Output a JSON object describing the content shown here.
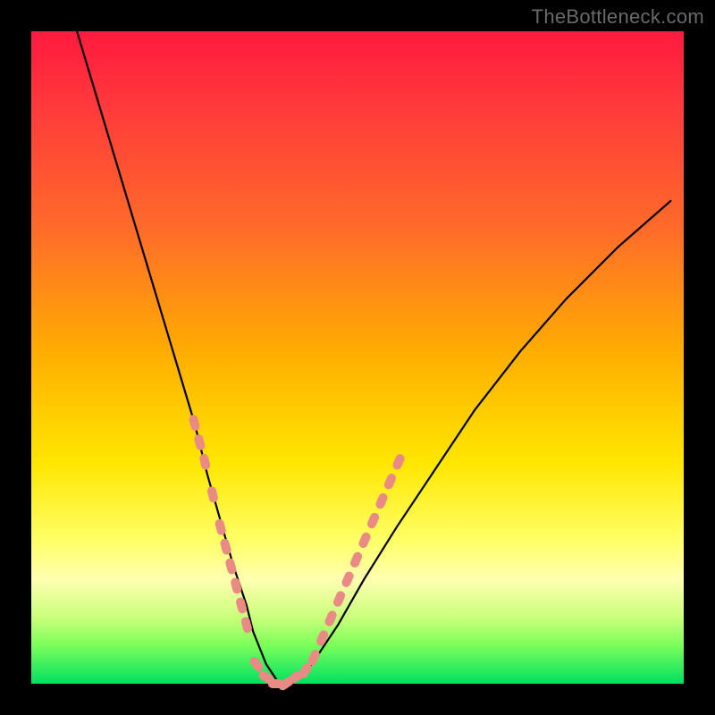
{
  "watermark": "TheBottleneck.com",
  "chart_data": {
    "type": "line",
    "title": "",
    "xlabel": "",
    "ylabel": "",
    "xlim": [
      0,
      100
    ],
    "ylim": [
      0,
      100
    ],
    "grid": false,
    "legend": false,
    "background_gradient": {
      "top": "#ff1a3f",
      "mid": "#ffe600",
      "bottom": "#00e060"
    },
    "series": [
      {
        "name": "bottleneck-curve",
        "color": "#000000",
        "x": [
          7,
          10,
          13,
          16,
          19,
          22,
          25,
          27,
          29,
          31,
          33,
          34,
          36,
          38,
          40,
          43,
          47,
          51,
          56,
          62,
          68,
          75,
          82,
          90,
          98
        ],
        "y": [
          100,
          90,
          80,
          70,
          60,
          50,
          40,
          32,
          25,
          18,
          12,
          8,
          3,
          0,
          0,
          3,
          9,
          16,
          24,
          33,
          42,
          51,
          59,
          67,
          74
        ]
      },
      {
        "name": "highlight-dots-left",
        "type": "scatter",
        "color": "#e98b84",
        "marker": "pill",
        "x": [
          25.0,
          25.8,
          26.6,
          27.8,
          29.0,
          29.8,
          30.6,
          31.4,
          32.2,
          33.0
        ],
        "y": [
          40,
          37,
          34,
          29,
          24,
          21,
          18,
          15,
          12,
          9
        ]
      },
      {
        "name": "highlight-dots-right",
        "type": "scatter",
        "color": "#e98b84",
        "marker": "pill",
        "x": [
          42.0,
          43.3,
          44.6,
          45.9,
          47.2,
          48.5,
          49.8,
          51.1,
          52.4,
          53.7,
          55.0,
          56.3
        ],
        "y": [
          2,
          4,
          7,
          10,
          13,
          16,
          19,
          22,
          25,
          28,
          31,
          34
        ]
      },
      {
        "name": "highlight-dots-bottom",
        "type": "scatter",
        "color": "#e98b84",
        "marker": "pill",
        "x": [
          34.5,
          36.0,
          37.5,
          39.0,
          40.5
        ],
        "y": [
          3,
          1,
          0,
          0,
          1
        ]
      }
    ]
  }
}
